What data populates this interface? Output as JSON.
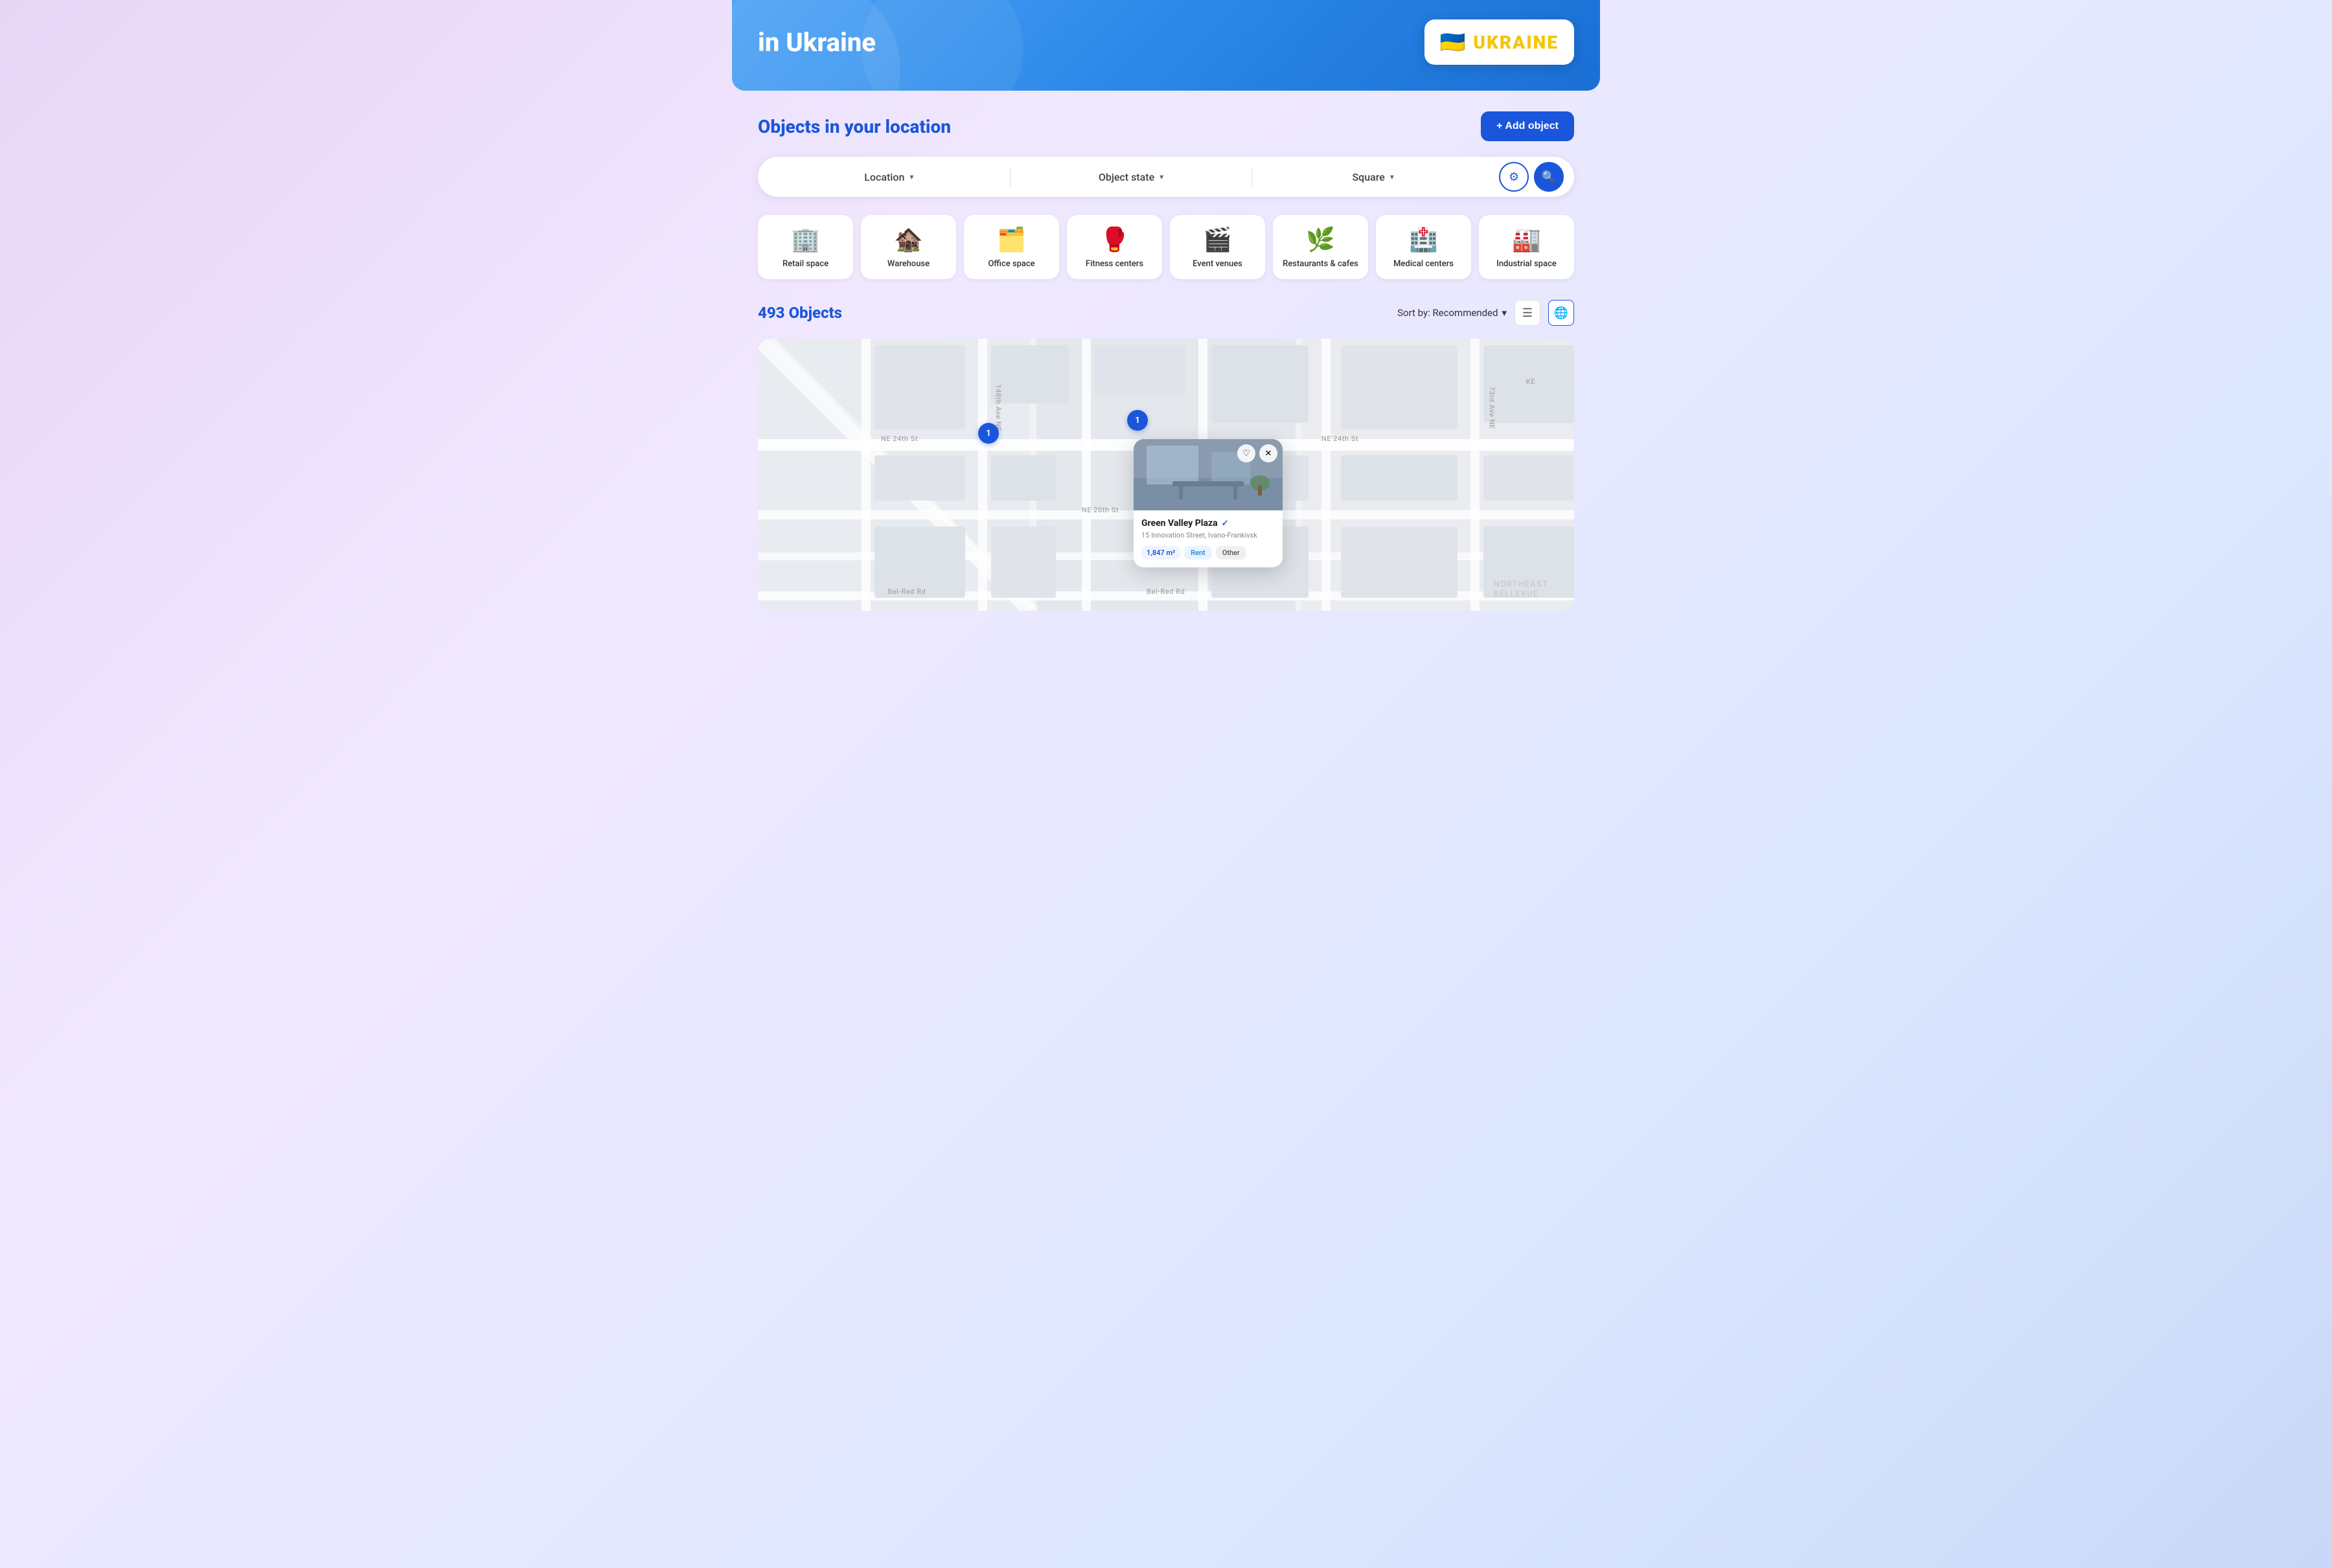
{
  "hero": {
    "text_line1": "in Ukraine",
    "ukraine_label": "UKRAINE",
    "flag_emoji": "🇺🇦"
  },
  "section": {
    "title": "Objects in your location",
    "add_button_label": "+ Add object"
  },
  "filters": {
    "location_label": "Location",
    "object_state_label": "Object state",
    "square_label": "Square"
  },
  "categories": [
    {
      "id": "retail",
      "icon": "🏢",
      "label": "Retail space"
    },
    {
      "id": "warehouse",
      "icon": "🏚️",
      "label": "Warehouse"
    },
    {
      "id": "office",
      "icon": "🗂️",
      "label": "Office space"
    },
    {
      "id": "fitness",
      "icon": "🥊",
      "label": "Fitness centers"
    },
    {
      "id": "events",
      "icon": "🎬",
      "label": "Event venues"
    },
    {
      "id": "restaurants",
      "icon": "🌿",
      "label": "Restaurants & cafes"
    },
    {
      "id": "medical",
      "icon": "🏥",
      "label": "Medical centers"
    },
    {
      "id": "industrial",
      "icon": "🏭",
      "label": "Industrial space"
    }
  ],
  "results": {
    "count": "493 Objects",
    "sort_label": "Sort by: Recommended"
  },
  "map_popup": {
    "title": "Green Valley Plaza",
    "address": "15 Innovation Street, Ivano-Frankivsk",
    "area": "1,847 m²",
    "tag1": "Rent",
    "tag2": "Other"
  },
  "map_markers": [
    {
      "value": "1",
      "position": "top-left"
    },
    {
      "value": "1",
      "position": "top-center"
    }
  ],
  "street_labels": [
    "NE 24th St",
    "NE 24th St",
    "NE 20th St",
    "Bel-Red Rd",
    "Bel-Red Rd",
    "148th Ave NE",
    "73rd Ave NE",
    "NORTHEAST BELLEVUE"
  ]
}
